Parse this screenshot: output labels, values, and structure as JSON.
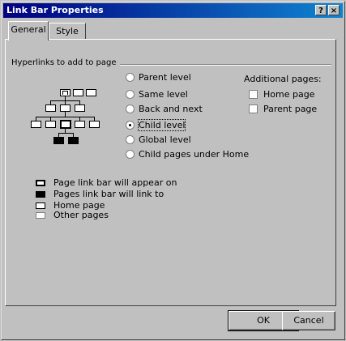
{
  "window": {
    "title": "Link Bar Properties",
    "help_glyph": "?",
    "close_glyph": "×"
  },
  "tabs": [
    {
      "label": "General"
    },
    {
      "label": "Style"
    }
  ],
  "group": {
    "label": "Hyperlinks to add to page"
  },
  "radios": [
    {
      "label": "Parent level"
    },
    {
      "label": "Same level"
    },
    {
      "label": "Back and next"
    },
    {
      "label": "Child level",
      "selected": true
    },
    {
      "label": "Global level"
    },
    {
      "label": "Child pages under Home"
    }
  ],
  "additional": {
    "heading": "Additional pages:",
    "items": [
      {
        "label": "Home page",
        "checked": false
      },
      {
        "label": "Parent page",
        "checked": false
      }
    ]
  },
  "legend": [
    {
      "label": "Page link bar will appear on",
      "icon": "page-appear-icon"
    },
    {
      "label": "Pages link bar will link to",
      "icon": "page-link-to-icon"
    },
    {
      "label": "Home page",
      "icon": "home-page-icon"
    },
    {
      "label": "Other pages",
      "icon": "other-page-icon"
    }
  ],
  "buttons": {
    "ok": "OK",
    "cancel": "Cancel"
  }
}
